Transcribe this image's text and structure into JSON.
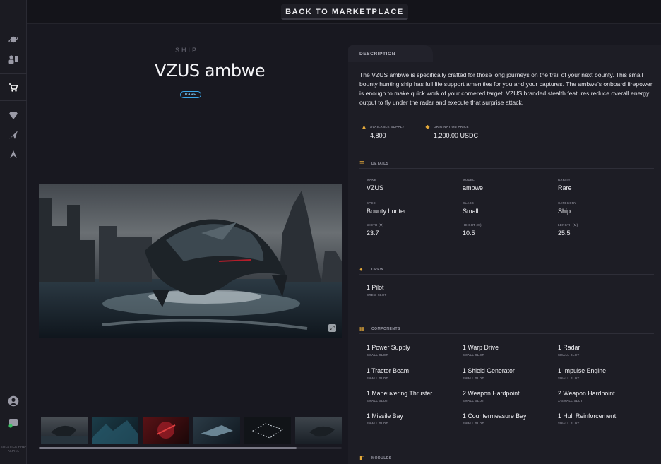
{
  "topbar": {
    "back_label": "BACK TO MARKETPLACE"
  },
  "rail": {
    "icons": [
      "planet-icon",
      "characters-icon",
      "cart-icon",
      "diamond-icon",
      "ship-icon",
      "arrow-logo-icon",
      "profile-icon",
      "wallet-icon"
    ],
    "version": "SOLSTICE PRE-ALPHA"
  },
  "product": {
    "category": "SHIP",
    "title": "VZUS ambwe",
    "rarity": "RARE"
  },
  "panel": {
    "tab_label": "DESCRIPTION",
    "description": "The VZUS ambwe is specifically crafted for those long journeys on the trail of your next bounty. This small bounty hunting ship has full life support amenities for you and your captures. The ambwe's onboard firepower is enough to make quick work of your cornered target. VZUS branded stealth features reduce overall energy output to fly under the radar and execute that surprise attack.",
    "supply": {
      "label": "AVAILABLE SUPPLY",
      "value": "4,800"
    },
    "price": {
      "label": "ORIGINATION PRICE",
      "value": "1,200.00 USDC"
    },
    "details_title": "DETAILS",
    "details": [
      {
        "k": "MAKE",
        "v": "VZUS"
      },
      {
        "k": "MODEL",
        "v": "ambwe"
      },
      {
        "k": "RARITY",
        "v": "Rare"
      },
      {
        "k": "SPEC",
        "v": "Bounty hunter"
      },
      {
        "k": "CLASS",
        "v": "Small"
      },
      {
        "k": "CATEGORY",
        "v": "Ship"
      },
      {
        "k": "WIDTH (M)",
        "v": "23.7"
      },
      {
        "k": "HEIGHT (M)",
        "v": "10.5"
      },
      {
        "k": "LENGTH (M)",
        "v": "25.5"
      }
    ],
    "crew_title": "CREW",
    "crew": {
      "name": "1 Pilot",
      "slot": "CREW SLOT"
    },
    "components_title": "COMPONENTS",
    "components": [
      {
        "n": "1 Power Supply",
        "s": "SMALL SLOT"
      },
      {
        "n": "1 Warp Drive",
        "s": "SMALL SLOT"
      },
      {
        "n": "1 Radar",
        "s": "SMALL SLOT"
      },
      {
        "n": "1 Tractor Beam",
        "s": "SMALL SLOT"
      },
      {
        "n": "1 Shield Generator",
        "s": "SMALL SLOT"
      },
      {
        "n": "1 Impulse Engine",
        "s": "SMALL SLOT"
      },
      {
        "n": "1 Maneuvering Thruster",
        "s": "SMALL SLOT"
      },
      {
        "n": "2 Weapon Hardpoint",
        "s": "SMALL SLOT"
      },
      {
        "n": "2 Weapon Hardpoint",
        "s": "X-SMALL SLOT"
      },
      {
        "n": "1 Missile Bay",
        "s": "SMALL SLOT"
      },
      {
        "n": "1 Countermeasure Bay",
        "s": "SMALL SLOT"
      },
      {
        "n": "1 Hull Reinforcement",
        "s": "SMALL SLOT"
      }
    ],
    "modules_title": "MODULES"
  },
  "gallery": {
    "scroll_fraction": 0.85
  },
  "colors": {
    "accent": "#e4a93a",
    "rarity": "#3aa6e8"
  }
}
